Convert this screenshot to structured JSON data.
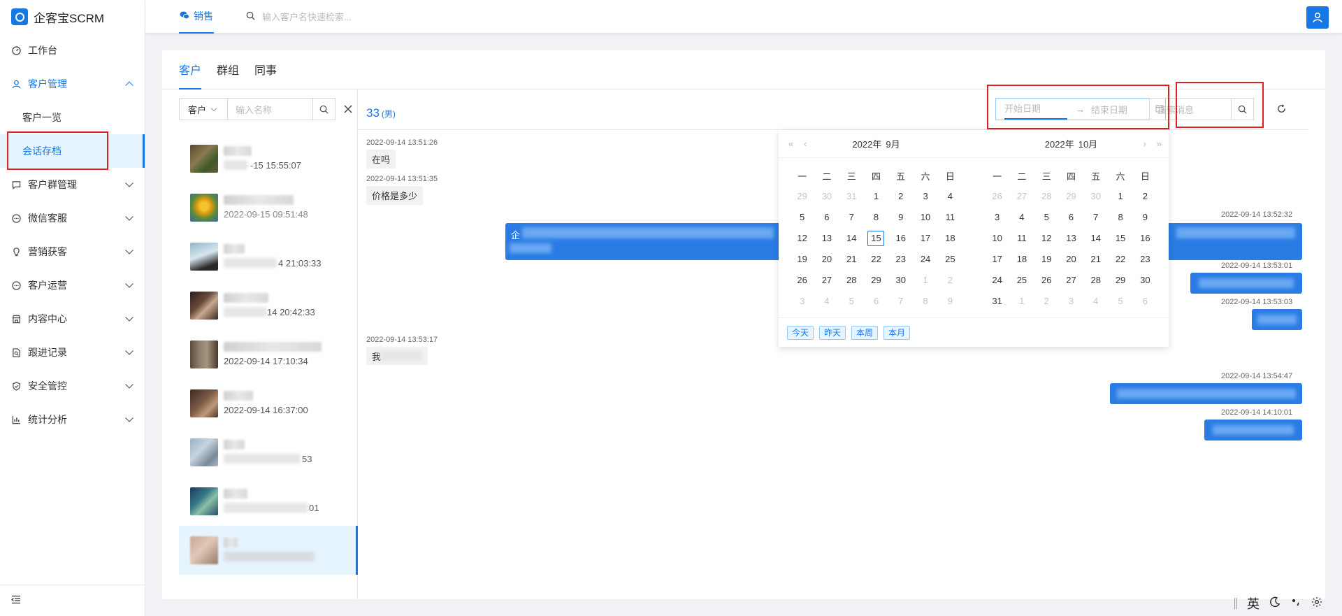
{
  "app": {
    "title": "企客宝SCRM"
  },
  "sidebar": {
    "items": [
      {
        "label": "工作台",
        "icon": "dashboard-icon"
      },
      {
        "label": "客户管理",
        "icon": "user-icon",
        "expanded": true
      },
      {
        "label": "客户群管理",
        "icon": "group-chat-icon"
      },
      {
        "label": "微信客服",
        "icon": "chat-icon"
      },
      {
        "label": "营销获客",
        "icon": "bulb-icon"
      },
      {
        "label": "客户运营",
        "icon": "chat-icon"
      },
      {
        "label": "内容中心",
        "icon": "shop-icon"
      },
      {
        "label": "跟进记录",
        "icon": "file-search-icon"
      },
      {
        "label": "安全管控",
        "icon": "shield-icon"
      },
      {
        "label": "统计分析",
        "icon": "bar-chart-icon"
      }
    ],
    "submenu": [
      {
        "label": "客户一览"
      },
      {
        "label": "会话存档",
        "selected": true
      }
    ]
  },
  "header": {
    "tab_label": "销售",
    "search_placeholder": "输入客户名快速检索..."
  },
  "tabs": [
    {
      "label": "客户",
      "active": true
    },
    {
      "label": "群组"
    },
    {
      "label": "同事"
    }
  ],
  "contact_filter": {
    "type_value": "客户",
    "name_placeholder": "输入名称"
  },
  "contacts": [
    {
      "time": "2022-09-15 15:55:07",
      "time_visible": "-15 15:55:07"
    },
    {
      "time": "2022-09-15 09:51:48",
      "time_visible": "2022-09-15 09:51:48"
    },
    {
      "time": "21:03:33",
      "time_visible": "4 21:03:33"
    },
    {
      "time": "20:42:33",
      "time_visible": "14 20:42:33"
    },
    {
      "time": "2022-09-14 17:10:34",
      "time_visible": "2022-09-14 17:10:34"
    },
    {
      "time": "2022-09-14 16:37:00",
      "time_visible": "2022-09-14 16:37:00"
    },
    {
      "time": "53",
      "time_visible": "53"
    },
    {
      "time": "01",
      "time_visible": "01"
    },
    {
      "time": "",
      "time_visible": ""
    }
  ],
  "chat": {
    "title_num": "33",
    "title_tag": "(男)",
    "date_range": {
      "start_placeholder": "开始日期",
      "end_placeholder": "结束日期",
      "separator": "→"
    },
    "search_placeholder": "搜索消息",
    "messages": [
      {
        "side": "left",
        "time": "2022-09-14 13:51:26",
        "text": "在吗"
      },
      {
        "side": "left",
        "time": "2022-09-14 13:51:35",
        "text": "价格是多少"
      },
      {
        "side": "right",
        "time": "2022-09-14 13:52:32",
        "text_prefix": "企"
      },
      {
        "side": "right",
        "time": "2022-09-14 13:53:01"
      },
      {
        "side": "right",
        "time": "2022-09-14 13:53:03"
      },
      {
        "side": "left",
        "time": "2022-09-14 13:53:17",
        "text_prefix": "我"
      },
      {
        "side": "right",
        "time": "2022-09-14 13:54:47"
      },
      {
        "side": "right",
        "time": "2022-09-14 14:10:01"
      }
    ]
  },
  "datepicker": {
    "left": {
      "year": "2022年",
      "month": "9月"
    },
    "right": {
      "year": "2022年",
      "month": "10月"
    },
    "weekdays": [
      "一",
      "二",
      "三",
      "四",
      "五",
      "六",
      "日"
    ],
    "left_days": [
      [
        "29",
        "30",
        "31",
        "1",
        "2",
        "3",
        "4"
      ],
      [
        "5",
        "6",
        "7",
        "8",
        "9",
        "10",
        "11"
      ],
      [
        "12",
        "13",
        "14",
        "15",
        "16",
        "17",
        "18"
      ],
      [
        "19",
        "20",
        "21",
        "22",
        "23",
        "24",
        "25"
      ],
      [
        "26",
        "27",
        "28",
        "29",
        "30",
        "1",
        "2"
      ],
      [
        "3",
        "4",
        "5",
        "6",
        "7",
        "8",
        "9"
      ]
    ],
    "right_days": [
      [
        "26",
        "27",
        "28",
        "29",
        "30",
        "1",
        "2"
      ],
      [
        "3",
        "4",
        "5",
        "6",
        "7",
        "8",
        "9"
      ],
      [
        "10",
        "11",
        "12",
        "13",
        "14",
        "15",
        "16"
      ],
      [
        "17",
        "18",
        "19",
        "20",
        "21",
        "22",
        "23"
      ],
      [
        "24",
        "25",
        "26",
        "27",
        "28",
        "29",
        "30"
      ],
      [
        "31",
        "1",
        "2",
        "3",
        "4",
        "5",
        "6"
      ]
    ],
    "today": "15",
    "presets": [
      "今天",
      "昨天",
      "本周",
      "本月"
    ]
  },
  "ime": {
    "lang": "英"
  },
  "colors": {
    "primary": "#1677e5",
    "highlight": "#e02020",
    "selected_bg": "#e6f4ff"
  }
}
